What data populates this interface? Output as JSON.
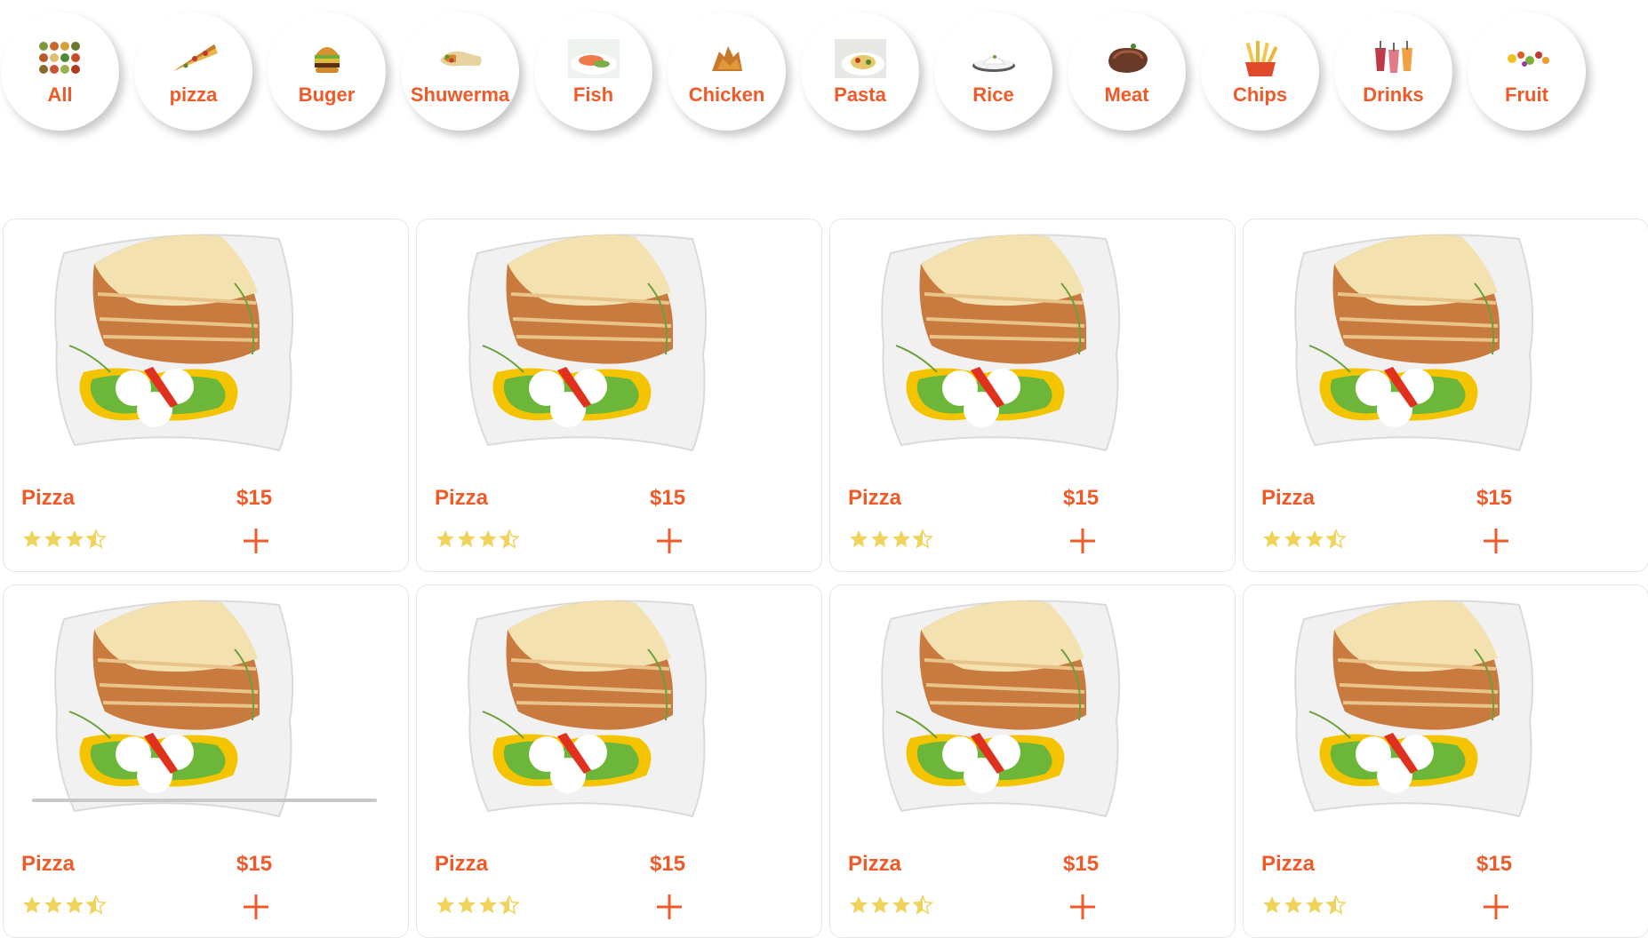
{
  "categories": [
    {
      "label": "All",
      "icon": "food-collage-icon"
    },
    {
      "label": "pizza",
      "icon": "pizza-slice-icon"
    },
    {
      "label": "Buger",
      "icon": "burger-icon"
    },
    {
      "label": "Shuwerma",
      "icon": "wrap-icon"
    },
    {
      "label": "Fish",
      "icon": "fish-plate-icon"
    },
    {
      "label": "Chicken",
      "icon": "fried-chicken-icon"
    },
    {
      "label": "Pasta",
      "icon": "pasta-icon"
    },
    {
      "label": "Rice",
      "icon": "rice-icon"
    },
    {
      "label": "Meat",
      "icon": "steak-icon"
    },
    {
      "label": "Chips",
      "icon": "fries-icon"
    },
    {
      "label": "Drinks",
      "icon": "drinks-icon"
    },
    {
      "label": "Fruit",
      "icon": "fruit-icon"
    }
  ],
  "products": [
    {
      "name": "Pizza",
      "price": "$15",
      "rating": 3.5,
      "icon": "lasagna-plate-image"
    },
    {
      "name": "Pizza",
      "price": "$15",
      "rating": 3.5,
      "icon": "lasagna-plate-image"
    },
    {
      "name": "Pizza",
      "price": "$15",
      "rating": 3.5,
      "icon": "lasagna-plate-image"
    },
    {
      "name": "Pizza",
      "price": "$15",
      "rating": 3.5,
      "icon": "lasagna-plate-image"
    },
    {
      "name": "Pizza",
      "price": "$15",
      "rating": 3.5,
      "icon": "lasagna-plate-image"
    },
    {
      "name": "Pizza",
      "price": "$15",
      "rating": 3.5,
      "icon": "lasagna-plate-image"
    },
    {
      "name": "Pizza",
      "price": "$15",
      "rating": 3.5,
      "icon": "lasagna-plate-image"
    },
    {
      "name": "Pizza",
      "price": "$15",
      "rating": 3.5,
      "icon": "lasagna-plate-image"
    }
  ],
  "colors": {
    "accent": "#f05a28",
    "star": "#f0d35a"
  }
}
